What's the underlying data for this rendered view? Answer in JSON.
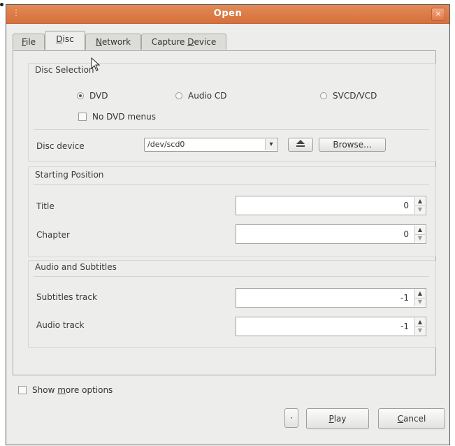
{
  "window": {
    "title": "Open",
    "close_label": "×",
    "grip": "⋮"
  },
  "tabs": [
    {
      "label_pre": "",
      "accel": "F",
      "label_post": "ile"
    },
    {
      "label_pre": "",
      "accel": "D",
      "label_post": "isc"
    },
    {
      "label_pre": "",
      "accel": "N",
      "label_post": "etwork"
    },
    {
      "label_pre": "Capture ",
      "accel": "D",
      "label_post": "evice"
    }
  ],
  "disc_selection": {
    "title": "Disc Selection",
    "options": [
      "DVD",
      "Audio CD",
      "SVCD/VCD"
    ],
    "selected": "DVD",
    "no_menus_label": "No DVD menus",
    "device_label": "Disc device",
    "device_value": "/dev/scd0",
    "browse_label": "Browse..."
  },
  "starting_position": {
    "title": "Starting Position",
    "title_label": "Title",
    "title_value": "0",
    "chapter_label": "Chapter",
    "chapter_value": "0"
  },
  "audio_subtitles": {
    "title": "Audio and Subtitles",
    "subtitles_label": "Subtitles track",
    "subtitles_value": "-1",
    "audio_label": "Audio track",
    "audio_value": "-1"
  },
  "footer": {
    "more_options_pre": "Show ",
    "more_options_accel": "m",
    "more_options_post": "ore options",
    "play_accel": "P",
    "play_post": "lay",
    "cancel_accel": "C",
    "cancel_post": "ancel",
    "small_button_label": "·"
  },
  "colors": {
    "titlebar": "#dd7b46",
    "window_bg": "#ededec"
  },
  "icons": [
    "close-icon",
    "eject-icon",
    "combo-arrow-icon",
    "spin-up-icon",
    "spin-down-icon",
    "mouse-pointer-icon"
  ]
}
